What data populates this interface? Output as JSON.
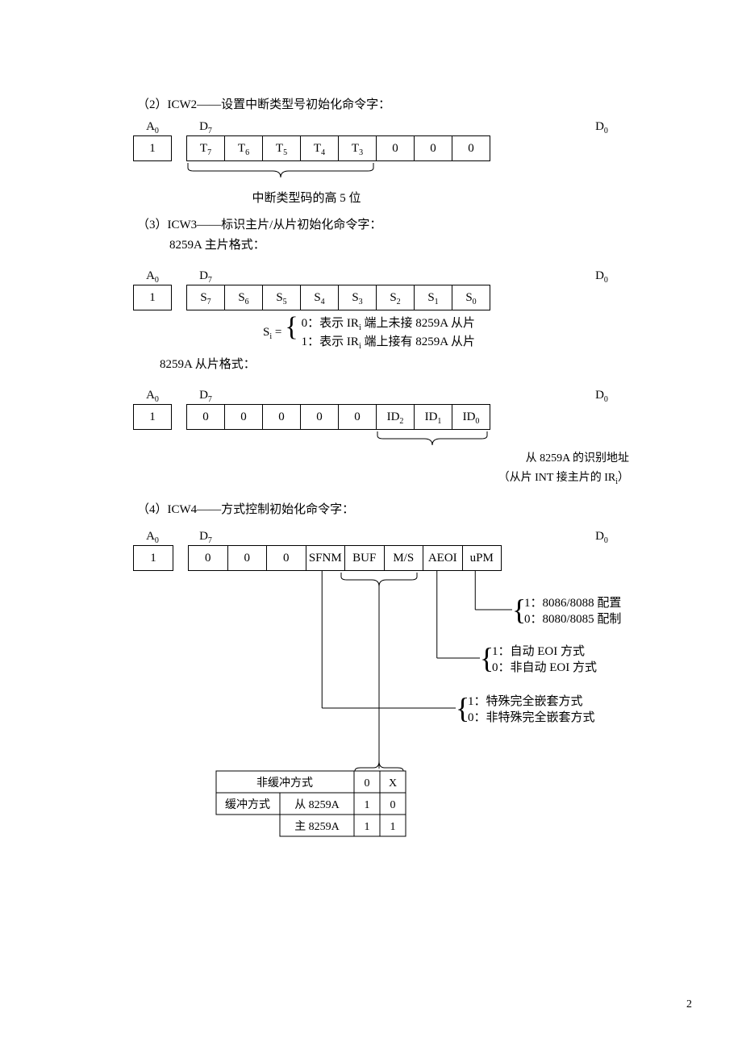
{
  "page_number": "2",
  "icw2": {
    "title": "（2）ICW2——设置中断类型号初始化命令字：",
    "labels": {
      "A0": "A0",
      "D7": "D7",
      "D0": "D0"
    },
    "a0": "1",
    "cells": [
      "T7",
      "T6",
      "T5",
      "T4",
      "T3",
      "0",
      "0",
      "0"
    ],
    "brace_caption": "中断类型码的高 5 位"
  },
  "icw3": {
    "title": "（3）ICW3——标识主片/从片初始化命令字：",
    "master_heading": "8259A 主片格式：",
    "master": {
      "labels": {
        "A0": "A0",
        "D7": "D7",
        "D0": "D0"
      },
      "a0": "1",
      "cells": [
        "S7",
        "S6",
        "S5",
        "S4",
        "S3",
        "S2",
        "S1",
        "S0"
      ]
    },
    "si_prefix": "Si =",
    "si_line0": "0：表示 IRi 端上未接 8259A 从片",
    "si_line1": "1：表示 IRi 端上接有 8259A 从片",
    "slave_heading": "8259A 从片格式：",
    "slave": {
      "labels": {
        "A0": "A0",
        "D7": "D7",
        "D0": "D0"
      },
      "a0": "1",
      "cells": [
        "0",
        "0",
        "0",
        "0",
        "0",
        "ID2",
        "ID1",
        "ID0"
      ]
    },
    "id_caption1": "从 8259A 的识别地址",
    "id_caption2": "（从片 INT 接主片的 IRi）"
  },
  "icw4": {
    "title": "（4）ICW4——方式控制初始化命令字：",
    "labels": {
      "A0": "A0",
      "D7": "D7",
      "D0": "D0"
    },
    "a0": "1",
    "cells": [
      "0",
      "0",
      "0",
      "SFNM",
      "BUF",
      "M/S",
      "AEOI",
      "uPM"
    ],
    "upm_1": "1：8086/8088 配置",
    "upm_0": "0：8080/8085 配制",
    "aeoi_1": "1：自动 EOI 方式",
    "aeoi_0": "0：非自动 EOI 方式",
    "sfnm_1": "1：特殊完全嵌套方式",
    "sfnm_0": "0：非特殊完全嵌套方式",
    "buf_table": {
      "r1": {
        "c1": "非缓冲方式",
        "c2": "0",
        "c3": "X"
      },
      "r2": {
        "a": "缓冲方式",
        "b": "从 8259A",
        "c2": "1",
        "c3": "0"
      },
      "r3": {
        "b": "主 8259A",
        "c2": "1",
        "c3": "1"
      }
    }
  }
}
